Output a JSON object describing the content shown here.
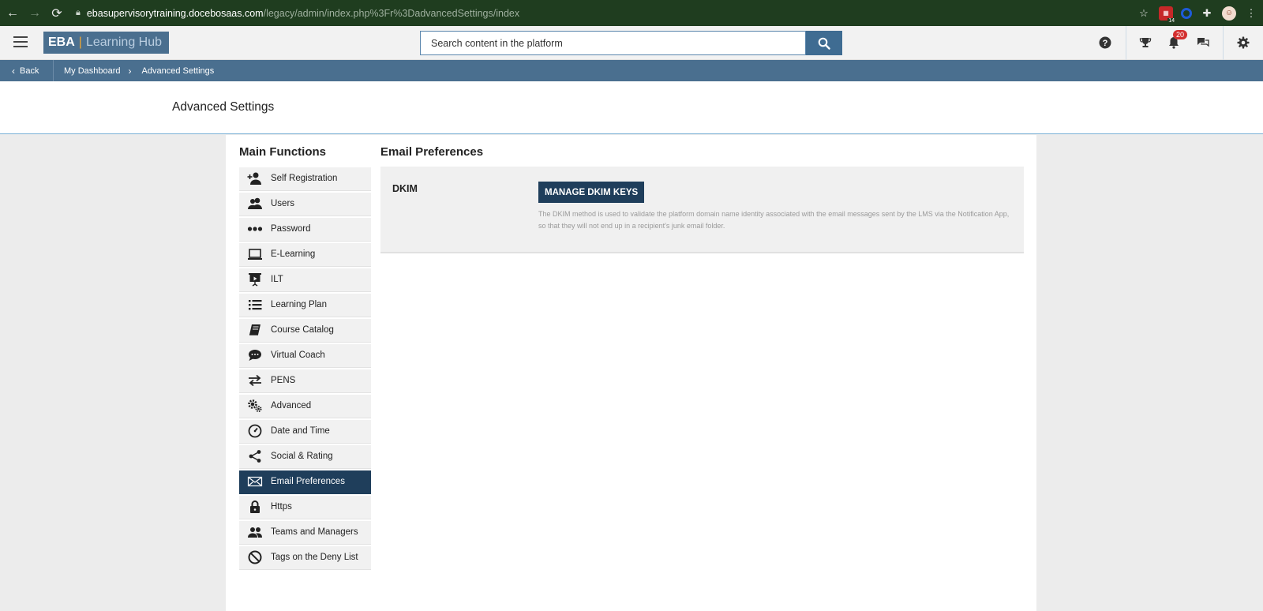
{
  "browser": {
    "url_host": "ebasupervisorytraining.docebosaas.com",
    "url_path": "/legacy/admin/index.php%3Fr%3DadvancedSettings/index",
    "extension_badge": "14"
  },
  "header": {
    "logo_left": "EBA",
    "logo_sep": "|",
    "logo_right": "Learning Hub",
    "search_placeholder": "Search content in the platform",
    "notifications_count": "20"
  },
  "breadcrumb": {
    "back_label": "Back",
    "items": [
      "My Dashboard",
      "Advanced Settings"
    ]
  },
  "page": {
    "title": "Advanced Settings"
  },
  "sidebar": {
    "title": "Main Functions",
    "items": [
      {
        "label": "Self Registration",
        "icon": "add-user-icon"
      },
      {
        "label": "Users",
        "icon": "users-icon"
      },
      {
        "label": "Password",
        "icon": "password-dots-icon"
      },
      {
        "label": "E-Learning",
        "icon": "laptop-icon"
      },
      {
        "label": "ILT",
        "icon": "presentation-icon"
      },
      {
        "label": "Learning Plan",
        "icon": "list-icon"
      },
      {
        "label": "Course Catalog",
        "icon": "book-icon"
      },
      {
        "label": "Virtual Coach",
        "icon": "chat-bubble-icon"
      },
      {
        "label": "PENS",
        "icon": "arrows-exchange-icon"
      },
      {
        "label": "Advanced",
        "icon": "gears-icon"
      },
      {
        "label": "Date and Time",
        "icon": "clock-icon"
      },
      {
        "label": "Social & Rating",
        "icon": "share-icon"
      },
      {
        "label": "Email Preferences",
        "icon": "envelope-icon",
        "active": true
      },
      {
        "label": "Https",
        "icon": "lock-icon"
      },
      {
        "label": "Teams and Managers",
        "icon": "team-icon"
      },
      {
        "label": "Tags on the Deny List",
        "icon": "deny-icon"
      }
    ]
  },
  "main": {
    "title": "Email Preferences",
    "dkim": {
      "label": "DKIM",
      "button_label": "MANAGE DKIM KEYS",
      "description": "The DKIM method is used to validate the platform domain name identity associated with the email messages sent by the LMS via the Notification App, so that they will not end up in a recipient's junk email folder."
    }
  },
  "colors": {
    "brand": "#4a6f8f",
    "active": "#1f3e5b",
    "badge": "#d32f2f"
  }
}
